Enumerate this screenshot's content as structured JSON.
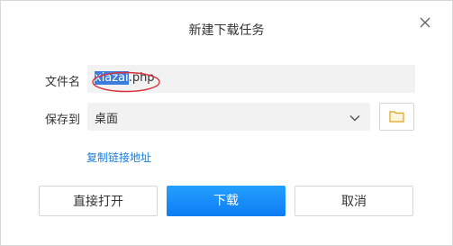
{
  "dialog": {
    "title": "新建下载任务",
    "close_icon": "close-icon"
  },
  "form": {
    "filename_label": "文件名",
    "filename_selected": "xiazai",
    "filename_rest": ".php",
    "saveto_label": "保存到",
    "saveto_value": "桌面",
    "dropdown_icon": "chevron-down-icon",
    "folder_icon": "folder-icon",
    "copy_link_label": "复制链接地址"
  },
  "buttons": {
    "open_label": "直接打开",
    "download_label": "下载",
    "cancel_label": "取消"
  },
  "colors": {
    "accent": "#1a8dfb",
    "link": "#1a7de0",
    "selection": "#3b7ddd",
    "annotation": "#d9303a"
  }
}
